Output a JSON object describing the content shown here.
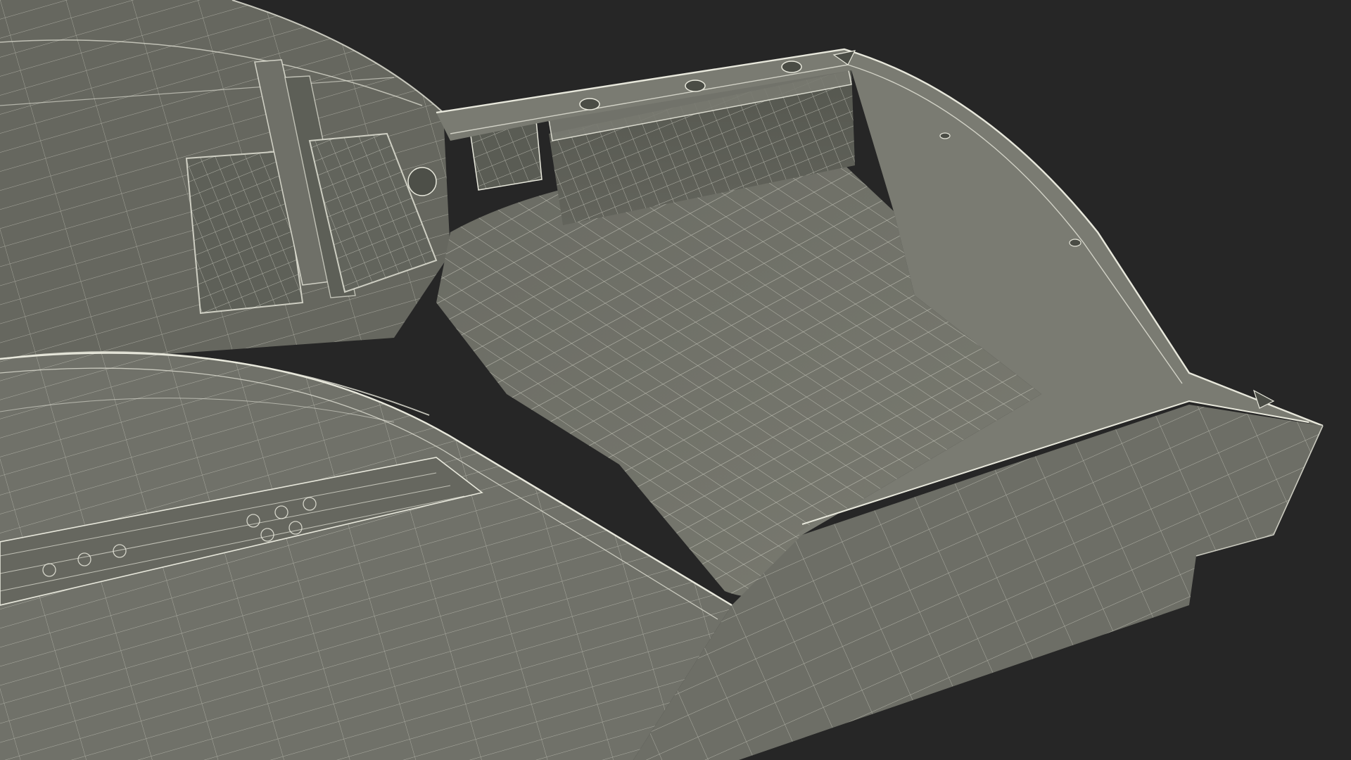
{
  "scene": {
    "subject": "boat-hull-wireframe-render",
    "colors": {
      "background": "#262626",
      "surface": "#6e6f66",
      "surface_dark": "#55574f",
      "surface_light": "#8a8b80",
      "wire": "#e8e8dc"
    }
  }
}
